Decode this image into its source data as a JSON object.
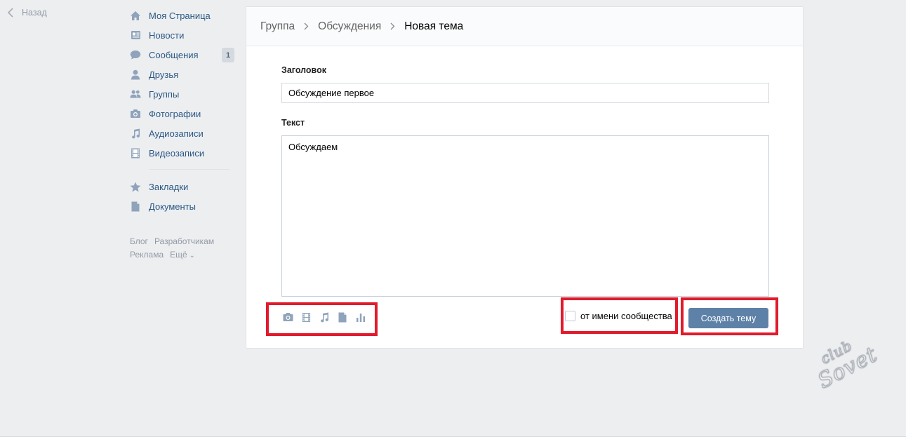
{
  "back": {
    "label": "Назад"
  },
  "nav": {
    "items": [
      {
        "label": "Моя Страница",
        "icon": "home-icon"
      },
      {
        "label": "Новости",
        "icon": "news-icon"
      },
      {
        "label": "Сообщения",
        "icon": "messages-icon",
        "badge": "1"
      },
      {
        "label": "Друзья",
        "icon": "friends-icon"
      },
      {
        "label": "Группы",
        "icon": "groups-icon"
      },
      {
        "label": "Фотографии",
        "icon": "camera-icon"
      },
      {
        "label": "Аудиозаписи",
        "icon": "music-note-icon"
      },
      {
        "label": "Видеозаписи",
        "icon": "film-icon"
      }
    ],
    "extra": [
      {
        "label": "Закладки",
        "icon": "star-icon"
      },
      {
        "label": "Документы",
        "icon": "document-icon"
      }
    ],
    "footer": {
      "blog": "Блог",
      "dev": "Разработчикам",
      "ads": "Реклама",
      "more": "Ещё"
    }
  },
  "breadcrumb": {
    "group": "Группа",
    "discussions": "Обсуждения",
    "current": "Новая тема"
  },
  "form": {
    "title_label": "Заголовок",
    "title_value": "Обсуждение первое",
    "text_label": "Текст",
    "text_value": "Обсуждаем",
    "attach_icons": [
      "camera-icon",
      "film-icon",
      "music-note-icon",
      "document-icon",
      "poll-icon"
    ],
    "community_label": "от имени сообщества",
    "submit_label": "Создать тему"
  },
  "watermark": {
    "text": "club Sovet"
  },
  "colors": {
    "accent": "#5e81a8",
    "link": "#2a5885",
    "highlight": "#e11a2c",
    "background": "#edeef0"
  }
}
